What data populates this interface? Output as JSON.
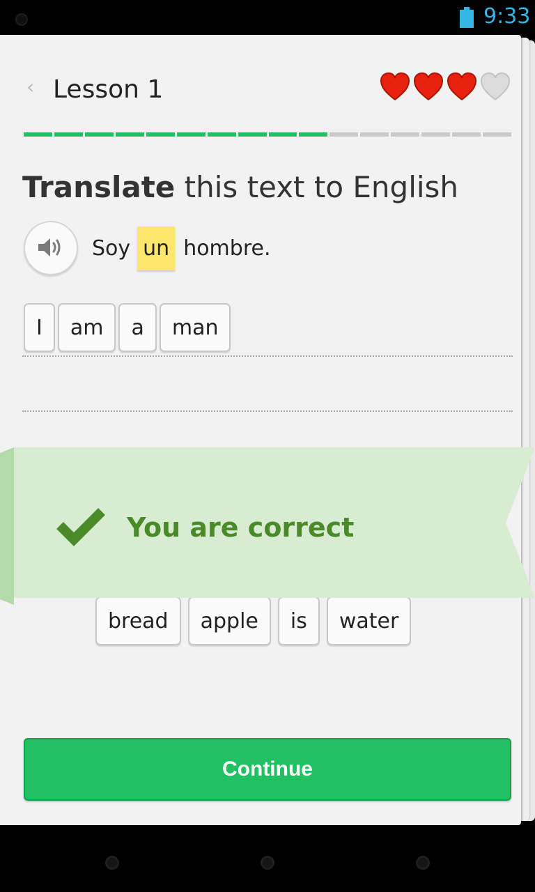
{
  "status": {
    "time": "9:33"
  },
  "header": {
    "back_icon": "‹",
    "title": "Lesson 1"
  },
  "hearts": [
    "heart-full",
    "heart-full",
    "heart-full",
    "heart-empty"
  ],
  "colors": {
    "accent": "#21c063",
    "heart": "#e8220e",
    "correct": "#4a8a2a",
    "ribbon": "#d8ecd2",
    "highlight": "#ffe66d"
  },
  "progress": {
    "completed": 10,
    "total": 16
  },
  "prompt": {
    "bold": "Translate",
    "rest": " this text to English"
  },
  "sentence": {
    "before": "Soy",
    "highlight": "un",
    "after": "hombre."
  },
  "answer_tiles": [
    "I",
    "am",
    "a",
    "man"
  ],
  "word_bank": [
    "bread",
    "apple",
    "is",
    "water"
  ],
  "feedback": {
    "text": "You are correct"
  },
  "continue": {
    "label": "Continue"
  }
}
